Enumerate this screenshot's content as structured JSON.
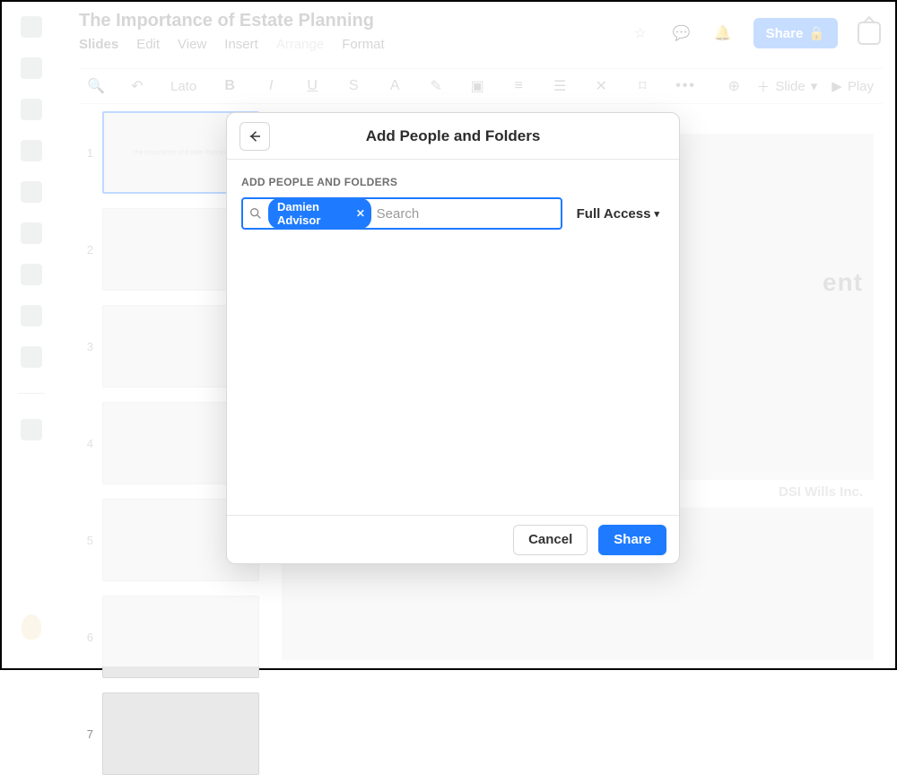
{
  "doc": {
    "title": "The Importance of Estate Planning"
  },
  "menubar": {
    "slides": "Slides",
    "edit": "Edit",
    "view": "View",
    "insert": "Insert",
    "arrange": "Arrange",
    "format": "Format"
  },
  "header_actions": {
    "share": "Share"
  },
  "toolbar": {
    "font": "Lato",
    "slide_menu": "Slide",
    "play": "Play"
  },
  "thumbs": {
    "indices": [
      "1",
      "2",
      "3",
      "4",
      "5",
      "6",
      "7"
    ],
    "slide1_caption": "The Importance of Estate Planning"
  },
  "canvas": {
    "watermark": "ent",
    "logo": "DSI Wills Inc."
  },
  "modal": {
    "title": "Add People and Folders",
    "section_label": "ADD PEOPLE AND FOLDERS",
    "chip": "Damien Advisor",
    "search_placeholder": "Search",
    "access_label": "Full Access",
    "cancel": "Cancel",
    "share": "Share"
  }
}
